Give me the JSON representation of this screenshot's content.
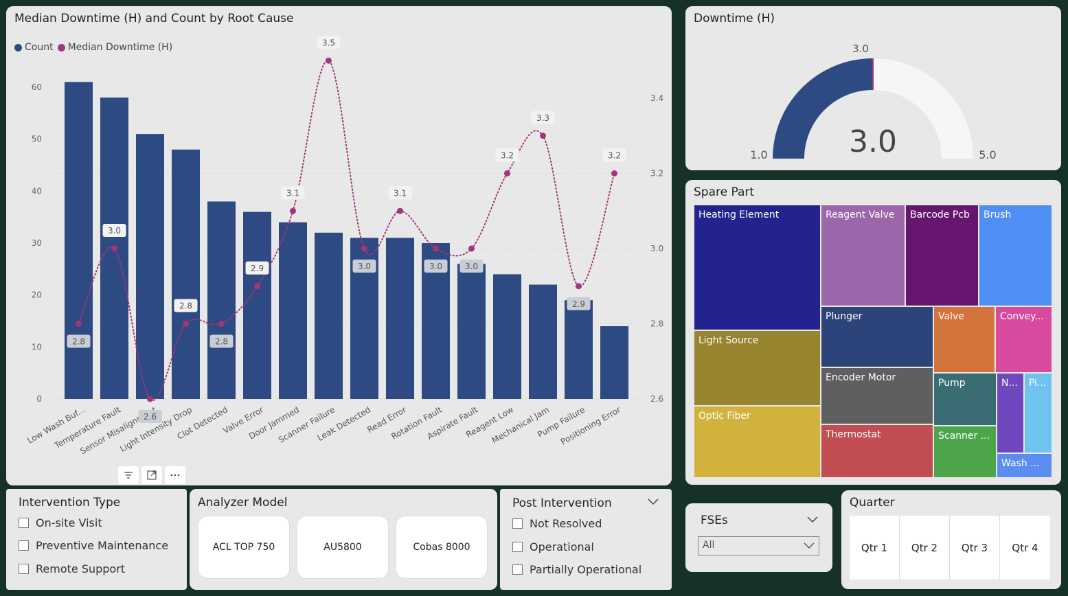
{
  "chart": {
    "title": "Median Downtime (H) and Count by Root Cause",
    "legend": [
      {
        "label": "Count",
        "color": "#2e4a82"
      },
      {
        "label": "Median Downtime (H)",
        "color": "#a3357a"
      }
    ]
  },
  "chart_data": {
    "type": "bar",
    "title": "Median Downtime (H) and Count by Root Cause",
    "categories": [
      "Low Wash Buf...",
      "Temperature Fault",
      "Sensor Misalignment",
      "Light Intensity Drop",
      "Clot Detected",
      "Valve Error",
      "Door Jammed",
      "Scanner Failure",
      "Leak Detected",
      "Read Error",
      "Rotation Fault",
      "Aspirate Fault",
      "Reagent Low",
      "Mechanical Jam",
      "Pump Failure",
      "Positioning Error"
    ],
    "series": [
      {
        "name": "Count",
        "type": "bar",
        "axis": "left",
        "values": [
          61,
          58,
          51,
          48,
          38,
          36,
          34,
          32,
          31,
          31,
          30,
          26,
          24,
          22,
          19,
          14
        ]
      },
      {
        "name": "Median Downtime (H)",
        "type": "line",
        "axis": "right",
        "values": [
          2.8,
          3.0,
          2.6,
          2.8,
          2.8,
          2.9,
          3.1,
          3.5,
          3.0,
          3.1,
          3.0,
          3.0,
          3.2,
          3.3,
          2.9,
          3.2
        ]
      }
    ],
    "ylim_left": [
      0,
      60
    ],
    "yticks_left": [
      "0",
      "10",
      "20",
      "30",
      "40",
      "50",
      "60"
    ],
    "ylim_right": [
      2.6,
      3.4
    ],
    "yticks_right": [
      "2.6",
      "2.8",
      "3.0",
      "3.2",
      "3.4"
    ],
    "point_labels": [
      "2.8",
      "3.0",
      "2.6",
      "2.8",
      "2.8",
      "2.9",
      "3.1",
      "3.5",
      "3.0",
      "3.1",
      "3.0",
      "3.0",
      "3.2",
      "3.3",
      "2.9",
      "3.2"
    ],
    "legend_position": "top-left",
    "grid": true
  },
  "gauge": {
    "title": "Downtime (H)",
    "value": 3.0,
    "value_label": "3.0",
    "min_label": "1.0",
    "max_label": "5.0",
    "target_label": "3.0",
    "min": 1.0,
    "max": 5.0,
    "color": "#2e4a82",
    "track_color": "#f6f6f6"
  },
  "treemap": {
    "title": "Spare Part",
    "items": [
      {
        "label": "Heating Element",
        "color": "#23238f"
      },
      {
        "label": "Reagent Valve",
        "color": "#9c66ab"
      },
      {
        "label": "Barcode Pcb",
        "color": "#66166f"
      },
      {
        "label": "Brush",
        "color": "#4f8ef5"
      },
      {
        "label": "Light Source",
        "color": "#97842e"
      },
      {
        "label": "Plunger",
        "color": "#2c4479"
      },
      {
        "label": "Valve",
        "color": "#d5733d"
      },
      {
        "label": "Convey...",
        "color": "#d84a9f"
      },
      {
        "label": "Encoder Motor",
        "color": "#5f5f5f"
      },
      {
        "label": "Pump",
        "color": "#3a6d73"
      },
      {
        "label": "N...",
        "color": "#6f47bf"
      },
      {
        "label": "Pi...",
        "color": "#6ec3ef"
      },
      {
        "label": "Optic Fiber",
        "color": "#d0b23c"
      },
      {
        "label": "Thermostat",
        "color": "#c24d52"
      },
      {
        "label": "Scanner ...",
        "color": "#4da54b"
      },
      {
        "label": "Wash ...",
        "color": "#5b8df0"
      }
    ]
  },
  "intervention": {
    "title": "Intervention Type",
    "options": [
      "On-site Visit",
      "Preventive Maintenance",
      "Remote Support"
    ]
  },
  "analyzer": {
    "title": "Analyzer Model",
    "options": [
      "ACL TOP 750",
      "AU5800",
      "Cobas 8000"
    ]
  },
  "post": {
    "title": "Post Intervention",
    "options": [
      "Not Resolved",
      "Operational",
      "Partially Operational"
    ]
  },
  "fse": {
    "title": "FSEs",
    "selected": "All"
  },
  "quarter": {
    "title": "Quarter",
    "options": [
      "Qtr 1",
      "Qtr 2",
      "Qtr 3",
      "Qtr 4"
    ]
  },
  "icons": {
    "filter": "filter-icon",
    "focus": "focus-mode-icon",
    "more": "more-options-icon",
    "chevron": "chevron-down-icon"
  }
}
